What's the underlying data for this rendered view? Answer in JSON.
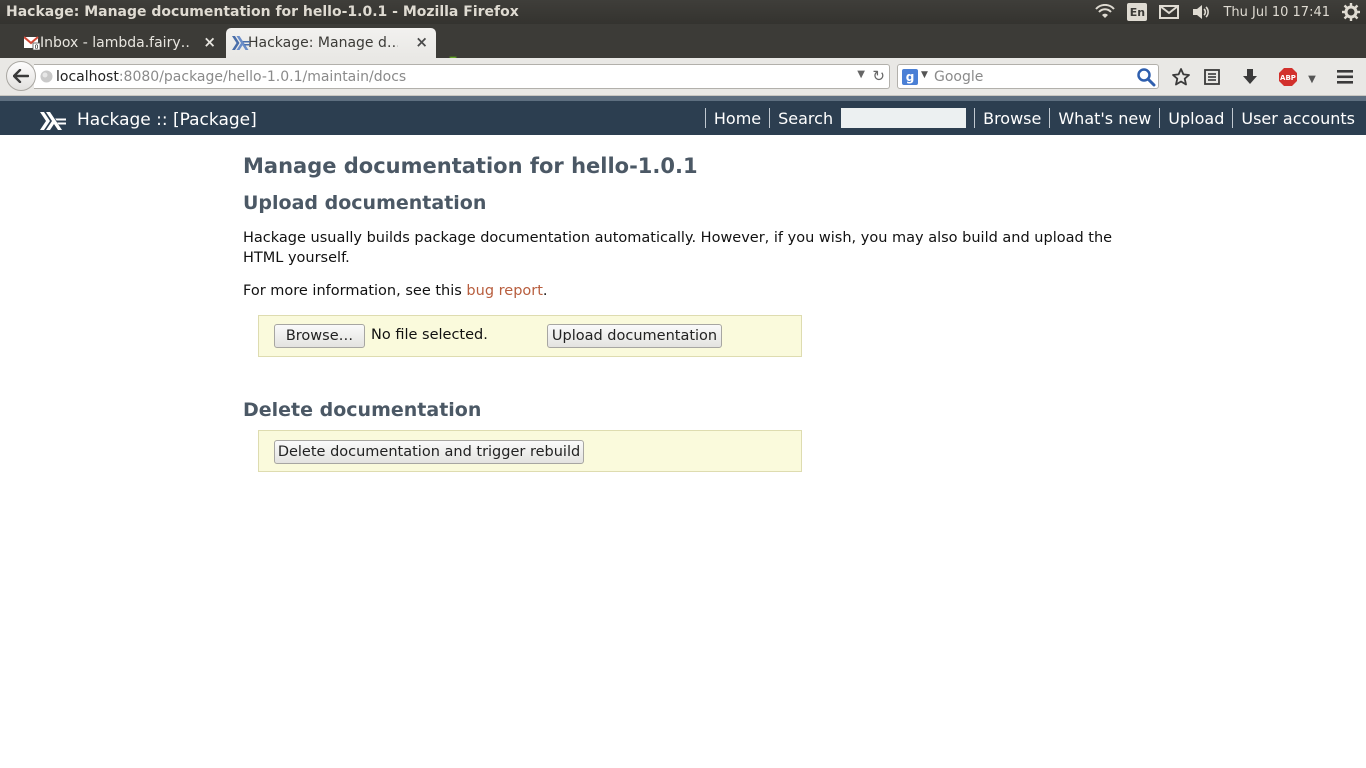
{
  "window": {
    "title": "Hackage: Manage documentation for hello-1.0.1 - Mozilla Firefox"
  },
  "system_tray": {
    "keyboard_layout": "En",
    "clock": "Thu Jul 10 17:41"
  },
  "tabs": [
    {
      "label": "Inbox - lambda.fairy…",
      "favicon": "gmail-icon",
      "active": false
    },
    {
      "label": "Hackage: Manage d…",
      "favicon": "haskell-icon",
      "active": true
    }
  ],
  "navbar": {
    "url_host": "localhost",
    "url_rest": ":8080/package/hello-1.0.1/maintain/docs",
    "search_placeholder": "Google"
  },
  "site_header": {
    "title": "Hackage :: [Package]",
    "nav": {
      "home": "Home",
      "search": "Search",
      "browse": "Browse",
      "whats_new": "What's new",
      "upload": "Upload",
      "user_accounts": "User accounts"
    }
  },
  "page": {
    "title": "Manage documentation for hello-1.0.1",
    "upload_section": {
      "heading": "Upload documentation",
      "para1": "Hackage usually builds package documentation automatically. However, if you wish, you may also build and upload the HTML yourself.",
      "para2_prefix": "For more information, see this ",
      "para2_link": "bug report",
      "para2_suffix": ".",
      "browse_label": "Browse…",
      "no_file_text": "No file selected.",
      "upload_button": "Upload documentation"
    },
    "delete_section": {
      "heading": "Delete documentation",
      "delete_button": "Delete documentation and trigger rebuild"
    }
  },
  "colors": {
    "header_bg": "#2c3e50",
    "heading_text": "#4b5865",
    "link": "#b85e3e",
    "form_box_bg": "#fafadc"
  }
}
